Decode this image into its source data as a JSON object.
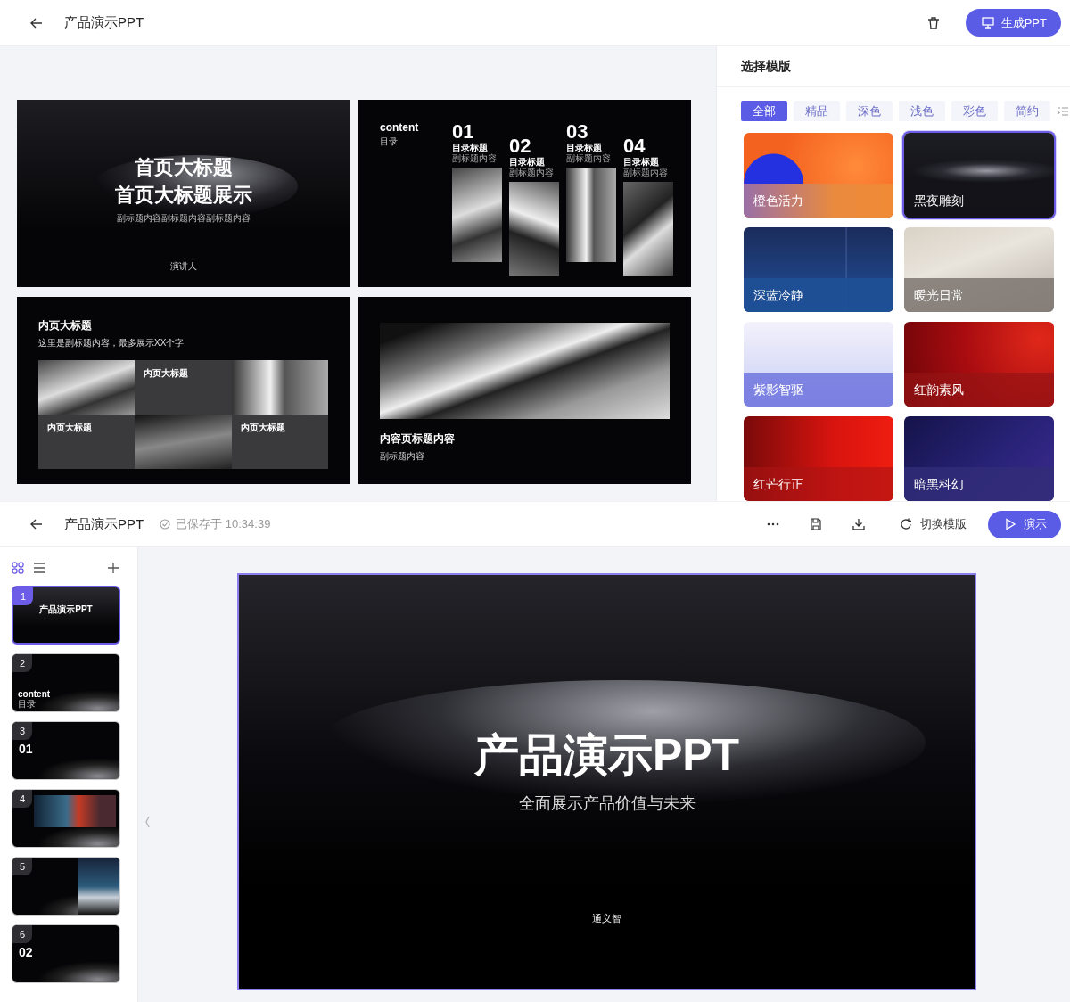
{
  "generator": {
    "title": "产品演示PPT",
    "generate_button": "生成PPT",
    "preview_slides": [
      {
        "kind": "cover",
        "title_lines": [
          "首页大标题",
          "首页大标题展示"
        ],
        "subtitle": "副标题内容副标题内容副标题内容",
        "presenter": "演讲人"
      },
      {
        "kind": "toc",
        "heading": "content",
        "subheading": "目录",
        "items": [
          {
            "number": "01",
            "title": "目录标题",
            "subtitle": "副标题内容"
          },
          {
            "number": "02",
            "title": "目录标题",
            "subtitle": "副标题内容"
          },
          {
            "number": "03",
            "title": "目录标题",
            "subtitle": "副标题内容"
          },
          {
            "number": "04",
            "title": "目录标题",
            "subtitle": "副标题内容"
          }
        ]
      },
      {
        "kind": "grid",
        "title": "内页大标题",
        "subtitle": "这里是副标题内容，最多展示XX个字",
        "blocks": [
          {
            "heading": "内页大标题"
          },
          {
            "heading": "内页大标题"
          },
          {
            "heading": "内页大标题"
          }
        ]
      },
      {
        "kind": "feature",
        "title": "内容页标题内容",
        "subtitle": "副标题内容"
      }
    ],
    "template_panel": {
      "title": "选择模版",
      "filters": [
        {
          "label": "全部",
          "selected": true
        },
        {
          "label": "精品",
          "selected": false
        },
        {
          "label": "深色",
          "selected": false
        },
        {
          "label": "浅色",
          "selected": false
        },
        {
          "label": "彩色",
          "selected": false
        },
        {
          "label": "简约",
          "selected": false
        }
      ],
      "templates": [
        {
          "name": "橙色活力",
          "kind": "orange",
          "selected": false
        },
        {
          "name": "黑夜雕刻",
          "kind": "night",
          "selected": true
        },
        {
          "name": "深蓝冷静",
          "kind": "navy",
          "selected": false
        },
        {
          "name": "暖光日常",
          "kind": "warm",
          "selected": false
        },
        {
          "name": "紫影智驱",
          "kind": "violet",
          "selected": false
        },
        {
          "name": "红韵素风",
          "kind": "crimson",
          "selected": false
        },
        {
          "name": "红芒行正",
          "kind": "red",
          "selected": false
        },
        {
          "name": "暗黑科幻",
          "kind": "cosmos",
          "selected": false
        }
      ]
    }
  },
  "editor": {
    "title": "产品演示PPT",
    "save_status": "已保存于 10:34:39",
    "switch_template_button": "切换模版",
    "present_button": "演示",
    "thumbnails": [
      {
        "number": "1",
        "kind": "cover",
        "title": "产品演示PPT",
        "selected": true
      },
      {
        "number": "2",
        "kind": "toc",
        "title": "content",
        "subtitle": "目录",
        "selected": false
      },
      {
        "number": "3",
        "kind": "section",
        "title": "01",
        "selected": false
      },
      {
        "number": "4",
        "kind": "photo",
        "selected": false
      },
      {
        "number": "5",
        "kind": "tech",
        "selected": false
      },
      {
        "number": "6",
        "kind": "section",
        "title": "02",
        "selected": false
      }
    ],
    "slide": {
      "title": "产品演示PPT",
      "subtitle": "全面展示产品价值与未来",
      "footer": "通义智"
    }
  }
}
